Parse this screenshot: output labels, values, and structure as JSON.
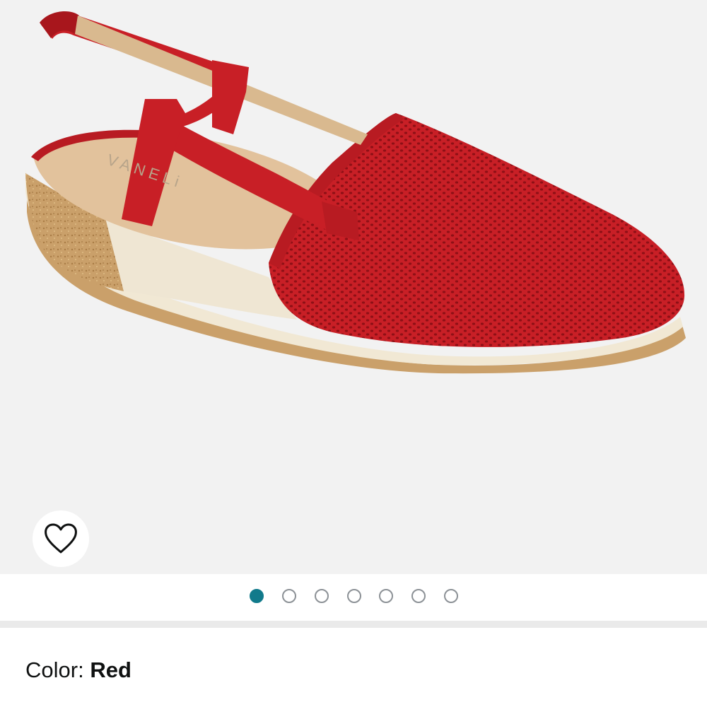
{
  "product": {
    "image": {
      "brand_mark": "VANELi",
      "colors": {
        "upper": "#c81f26",
        "sole": "#f1e8d4",
        "wedge_cork": "#caa06a",
        "insole": "#e2c29c",
        "background": "#f2f2f2"
      }
    },
    "wishlist": {
      "icon": "heart-outline-icon"
    },
    "carousel": {
      "count": 7,
      "active_index": 0,
      "active_color": "#117a8b",
      "inactive_color": "#8c9196"
    },
    "color": {
      "label": "Color: ",
      "value": "Red"
    }
  }
}
